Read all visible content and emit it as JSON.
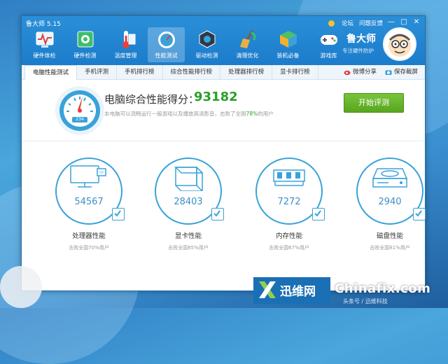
{
  "window": {
    "title": "鲁大师 5.15",
    "links": [
      "论坛",
      "问题反馈"
    ],
    "controls": [
      "—",
      "□",
      "✕"
    ]
  },
  "toolbar": [
    {
      "label": "硬件体检",
      "icon": "health-check-icon"
    },
    {
      "label": "硬件检测",
      "icon": "chip-icon"
    },
    {
      "label": "温度管理",
      "icon": "thermometer-icon"
    },
    {
      "label": "性能测试",
      "icon": "speedometer-icon"
    },
    {
      "label": "驱动检测",
      "icon": "driver-icon"
    },
    {
      "label": "清理优化",
      "icon": "broom-icon"
    },
    {
      "label": "装机必备",
      "icon": "cube-icon"
    },
    {
      "label": "游戏库",
      "icon": "gamepad-icon"
    }
  ],
  "brand": {
    "name": "鲁大师",
    "slogan": "专注硬件防护"
  },
  "tabs": [
    "电脑性能测试",
    "手机评测",
    "手机排行榜",
    "综合性能排行榜",
    "处理器排行榜",
    "显卡排行榜"
  ],
  "tab_actions": {
    "share": "微博分享",
    "save": "保存截屏"
  },
  "score": {
    "title": "电脑综合性能得分：",
    "value": "93182",
    "desc_prefix": "本电脑可以流畅运行一般游戏以及播放高清影音，击败了全国",
    "desc_pct": "78%",
    "desc_suffix": "的用户",
    "gauge_label": "234",
    "start_button": "开始评测"
  },
  "cards": [
    {
      "value": "54567",
      "name": "处理器性能",
      "sub": "击败全国70%用户",
      "icon": "cpu-icon"
    },
    {
      "value": "28403",
      "name": "显卡性能",
      "sub": "击败全国85%用户",
      "icon": "gpu-icon"
    },
    {
      "value": "7272",
      "name": "内存性能",
      "sub": "击败全国67%用户",
      "icon": "memory-icon"
    },
    {
      "value": "2940",
      "name": "磁盘性能",
      "sub": "击败全国81%用户",
      "icon": "disk-icon"
    }
  ],
  "watermark": {
    "cn": "迅维网",
    "en": "Chinafix.com",
    "small": "头条号 / 迅维科技"
  },
  "colors": {
    "titlebar": "#1c7ccb",
    "accent": "#3aa2da",
    "score": "#2a9f2a",
    "button": "#58a620"
  }
}
